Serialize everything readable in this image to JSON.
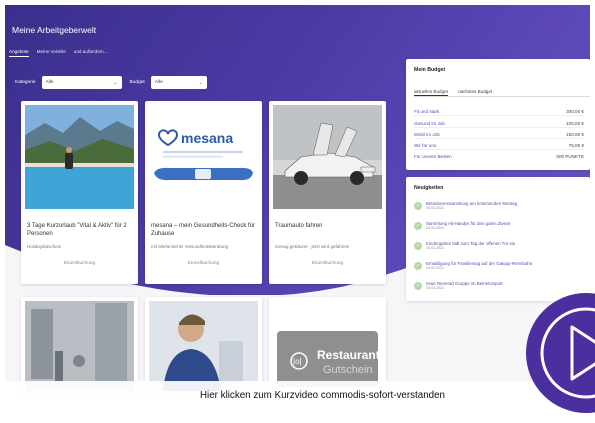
{
  "app": {
    "title": "Meine Arbeitgeberwelt"
  },
  "tabs": [
    {
      "label": "Angebote",
      "active": true
    },
    {
      "label": "Meine Vorteile",
      "active": false
    },
    {
      "label": "und außerdem...",
      "active": false
    }
  ],
  "filters": {
    "category_label": "Kategorie",
    "category_value": "Alle",
    "budget_label": "Budget",
    "budget_value": "Alle"
  },
  "cards": [
    {
      "title": "3 Tage Kurzurlaub \"Vital & Aktiv\" für 2 Personen",
      "subtitle": "Holidaydutschein",
      "action": "Einzelbuchung"
    },
    {
      "title": "mesana – mein Gesundheits-Check für Zuhause",
      "subtitle": "mit telefonischer Gesundheitsberatung",
      "action": "Einzelbuchung",
      "logo": "mesana"
    },
    {
      "title": "Traumauto fahren",
      "subtitle": "Genug geträumt - jetzt wird gefahren!",
      "action": "Einzelbuchung"
    },
    {
      "overlay_title": "Restaurant",
      "overlay_sub": "Gutschein"
    }
  ],
  "budget": {
    "title": "Mein Budget",
    "tabs": [
      "aktuelles Budget",
      "nächstes Budget"
    ],
    "rows": [
      {
        "label": "Fit und stark",
        "value": "300,00  €"
      },
      {
        "label": "Gesund im Job",
        "value": "100,00  €"
      },
      {
        "label": "Mobil im Job",
        "value": "150,00  €"
      },
      {
        "label": "Wir für uns",
        "value": "75,00  €"
      },
      {
        "label": "Für unsere Besten",
        "value": "500  PUNKTE"
      }
    ]
  },
  "news": {
    "title": "Neuigkeiten",
    "items": [
      {
        "text": "Betriebsversammlung am kommenden Montag",
        "date": "24.02.2021"
      },
      {
        "text": "Sammlung Alt-Handys für den guten Zweck",
        "date": "24.02.2021"
      },
      {
        "text": "Kindergarten lädt zum Tag der offenen Tür ein",
        "date": "24.02.2021"
      },
      {
        "text": "Ermäßigung für Familientag auf der Galopp-Rennbahn",
        "date": "24.02.2021"
      },
      {
        "text": "neue Rennrad Gruppe im Betriebssport",
        "date": "24.02.2021"
      }
    ]
  },
  "caption": "Hier klicken zum Kurzvideo commodis-sofort-verstanden",
  "colors": {
    "hero": "#4a3aa3",
    "accent": "#5b4ab0",
    "check": "#b7d8a8"
  }
}
